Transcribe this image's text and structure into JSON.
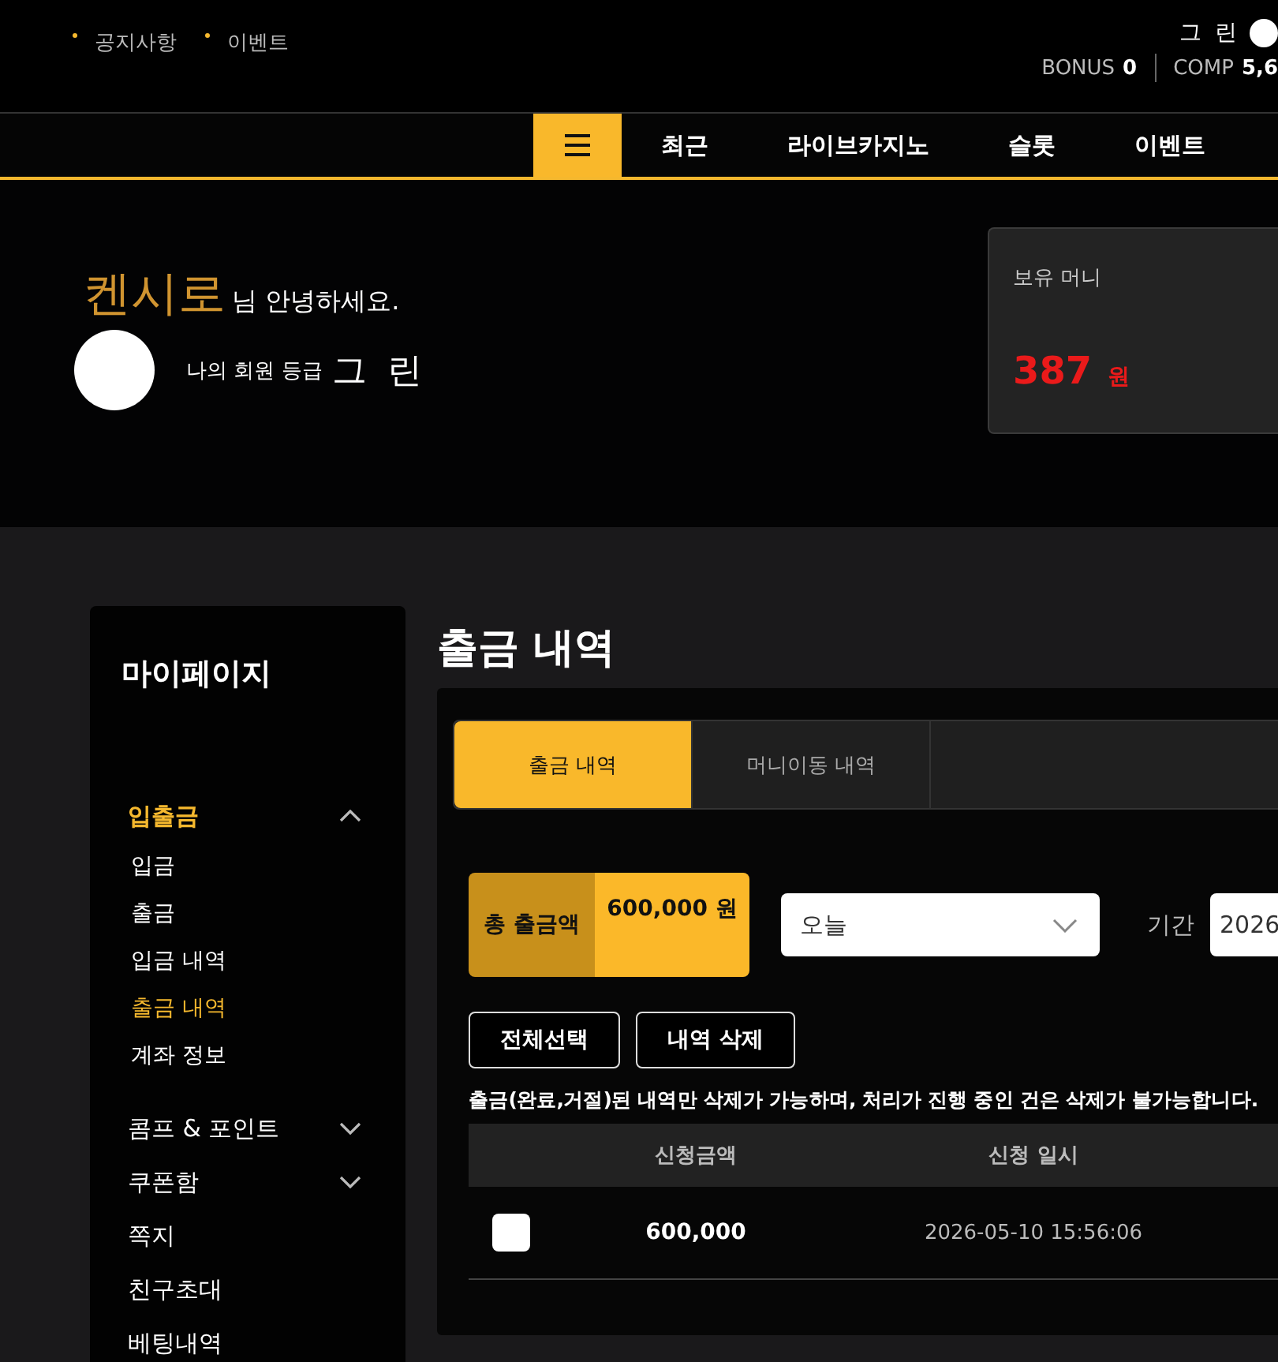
{
  "top_links": [
    "공지사항",
    "이벤트"
  ],
  "user": {
    "grade": "그 린",
    "bonus_label": "BONUS",
    "bonus_value": "0",
    "comp_label": "COMP",
    "comp_value": "5,6"
  },
  "nav": {
    "items": [
      "최근",
      "라이브카지노",
      "슬롯",
      "이벤트"
    ]
  },
  "greeting": {
    "name": "켄시로",
    "suffix": "님 안녕하세요.",
    "grade_label": "나의 회원 등급",
    "grade": "그 린"
  },
  "money_card": {
    "label": "보유 머니",
    "amount": "387",
    "unit": "원"
  },
  "sidebar": {
    "title": "마이페이지",
    "items": [
      {
        "label": "입출금",
        "selected": true,
        "expanded": true,
        "children": [
          {
            "label": "입금",
            "selected": false
          },
          {
            "label": "출금",
            "selected": false
          },
          {
            "label": "입금 내역",
            "selected": false
          },
          {
            "label": "출금 내역",
            "selected": true
          },
          {
            "label": "계좌 정보",
            "selected": false
          }
        ]
      },
      {
        "label": "콤프 & 포인트",
        "selected": false,
        "expanded": false
      },
      {
        "label": "쿠폰함",
        "selected": false,
        "expanded": false
      },
      {
        "label": "쪽지",
        "selected": false
      },
      {
        "label": "친구초대",
        "selected": false
      },
      {
        "label": "베팅내역",
        "selected": false
      }
    ]
  },
  "page_title": "출금 내역",
  "tabs": [
    {
      "label": "출금 내역",
      "selected": true
    },
    {
      "label": "머니이동 내역",
      "selected": false
    }
  ],
  "summary": {
    "label": "총 출금액",
    "value": "600,000 원"
  },
  "period_select": {
    "value": "오늘"
  },
  "period": {
    "label": "기간",
    "value": "2026"
  },
  "buttons": [
    "전체선택",
    "내역 삭제"
  ],
  "notice": "출금(완료,거절)된 내역만 삭제가 가능하며, 처리가 진행 중인 건은 삭제가 불가능합니다.",
  "table": {
    "columns": [
      "신청금액",
      "신청 일시"
    ],
    "rows": [
      {
        "checked": false,
        "amount": "600,000",
        "datetime": "2026-05-10 15:56:06"
      }
    ]
  }
}
